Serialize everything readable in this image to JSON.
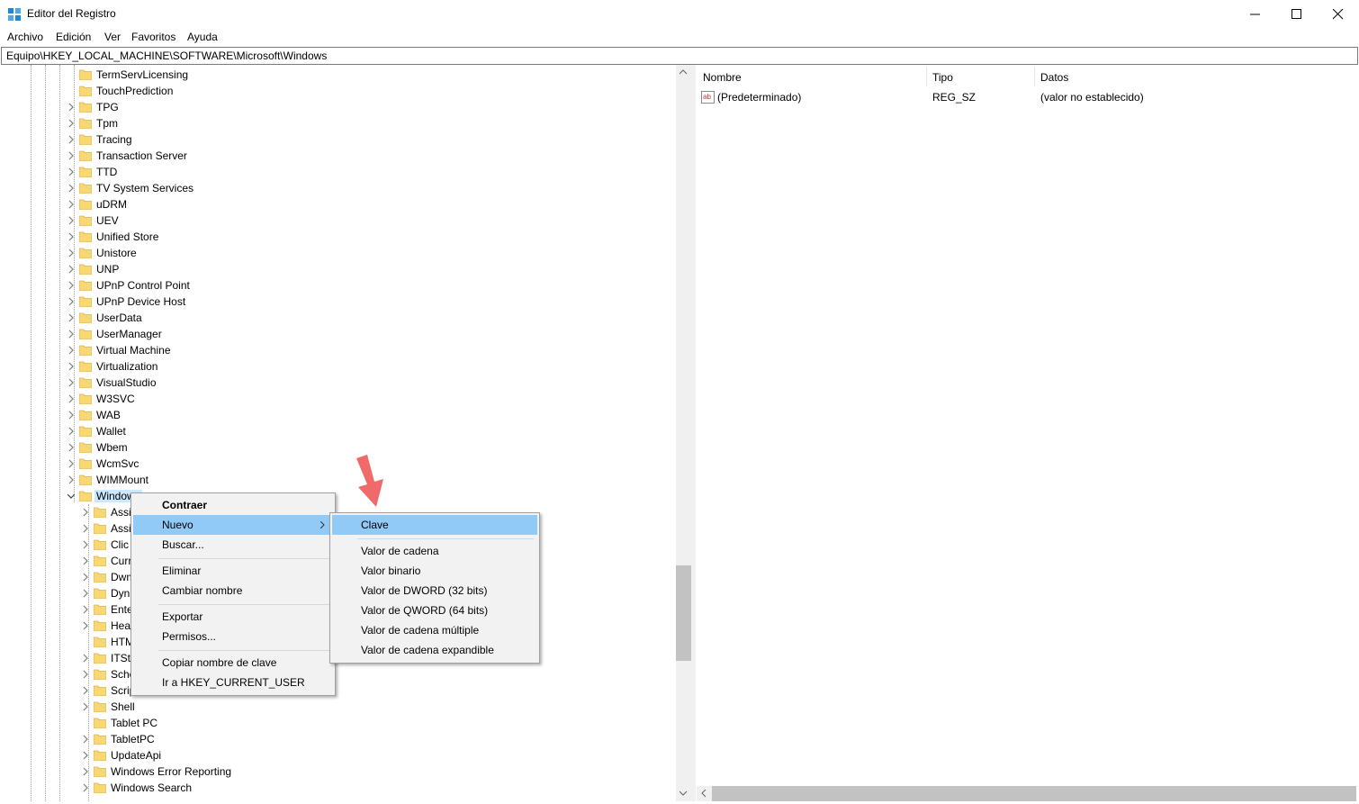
{
  "window": {
    "title": "Editor del Registro",
    "controls": [
      "minimize",
      "maximize",
      "close"
    ]
  },
  "menubar": [
    "Archivo",
    "Edición",
    "Ver",
    "Favoritos",
    "Ayuda"
  ],
  "address": "Equipo\\HKEY_LOCAL_MACHINE\\SOFTWARE\\Microsoft\\Windows",
  "tree": {
    "items": [
      {
        "label": "TermServLicensing",
        "expandable": false
      },
      {
        "label": "TouchPrediction",
        "expandable": false
      },
      {
        "label": "TPG",
        "expandable": true
      },
      {
        "label": "Tpm",
        "expandable": true
      },
      {
        "label": "Tracing",
        "expandable": true
      },
      {
        "label": "Transaction Server",
        "expandable": true
      },
      {
        "label": "TTD",
        "expandable": true
      },
      {
        "label": "TV System Services",
        "expandable": true
      },
      {
        "label": "uDRM",
        "expandable": true
      },
      {
        "label": "UEV",
        "expandable": true
      },
      {
        "label": "Unified Store",
        "expandable": true
      },
      {
        "label": "Unistore",
        "expandable": true
      },
      {
        "label": "UNP",
        "expandable": true
      },
      {
        "label": "UPnP Control Point",
        "expandable": true
      },
      {
        "label": "UPnP Device Host",
        "expandable": true
      },
      {
        "label": "UserData",
        "expandable": true
      },
      {
        "label": "UserManager",
        "expandable": true
      },
      {
        "label": "Virtual Machine",
        "expandable": true
      },
      {
        "label": "Virtualization",
        "expandable": true
      },
      {
        "label": "VisualStudio",
        "expandable": true
      },
      {
        "label": "W3SVC",
        "expandable": true
      },
      {
        "label": "WAB",
        "expandable": true
      },
      {
        "label": "Wallet",
        "expandable": true
      },
      {
        "label": "Wbem",
        "expandable": true
      },
      {
        "label": "WcmSvc",
        "expandable": true
      },
      {
        "label": "WIMMount",
        "expandable": true
      },
      {
        "label": "Windows",
        "expandable": true,
        "expanded": true,
        "selected": true
      }
    ],
    "children": [
      {
        "label": "Assi",
        "expandable": true
      },
      {
        "label": "Assi",
        "expandable": true
      },
      {
        "label": "Clic",
        "expandable": true
      },
      {
        "label": "Curr",
        "expandable": true
      },
      {
        "label": "Dwm",
        "expandable": true
      },
      {
        "label": "Dyn",
        "expandable": true
      },
      {
        "label": "Ente",
        "expandable": true
      },
      {
        "label": "Hea",
        "expandable": true
      },
      {
        "label": "HTM",
        "expandable": false
      },
      {
        "label": "ITSt",
        "expandable": true
      },
      {
        "label": "Sche",
        "expandable": true
      },
      {
        "label": "Scrip",
        "expandable": true
      },
      {
        "label": "Shell",
        "expandable": true
      },
      {
        "label": "Tablet PC",
        "expandable": false
      },
      {
        "label": "TabletPC",
        "expandable": true
      },
      {
        "label": "UpdateApi",
        "expandable": true
      },
      {
        "label": "Windows Error Reporting",
        "expandable": true
      },
      {
        "label": "Windows Search",
        "expandable": true
      }
    ]
  },
  "list": {
    "columns": [
      "Nombre",
      "Tipo",
      "Datos"
    ],
    "rows": [
      {
        "name": "(Predeterminado)",
        "type": "REG_SZ",
        "data": "(valor no establecido)"
      }
    ]
  },
  "context_menu": {
    "items": [
      "Contraer",
      "Nuevo",
      "Buscar...",
      "Eliminar",
      "Cambiar nombre",
      "Exportar",
      "Permisos...",
      "Copiar nombre de clave",
      "Ir a HKEY_CURRENT_USER"
    ],
    "highlighted": "Nuevo"
  },
  "submenu": {
    "items": [
      "Clave",
      "Valor de cadena",
      "Valor binario",
      "Valor de DWORD (32 bits)",
      "Valor de QWORD (64 bits)",
      "Valor de cadena múltiple",
      "Valor de cadena expandible"
    ],
    "highlighted": "Clave"
  },
  "colors": {
    "highlight": "#91c9f7",
    "selection": "#cce8ff",
    "folder": "#f8d775",
    "annotation_arrow": "#f06a6a"
  }
}
